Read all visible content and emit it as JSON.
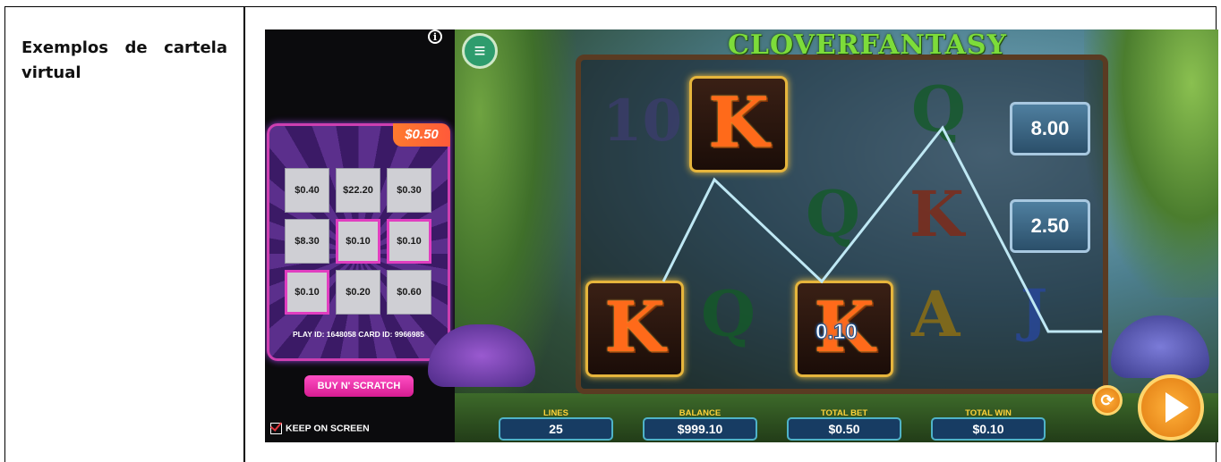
{
  "doc": {
    "label": "Exemplos de cartela virtual"
  },
  "scratch_card": {
    "info": "i",
    "price": "$0.50",
    "cells": [
      "$0.40",
      "$22.20",
      "$0.30",
      "$8.30",
      "$0.10",
      "$0.10",
      "$0.10",
      "$0.20",
      "$0.60"
    ],
    "highlighted": [
      false,
      false,
      false,
      false,
      true,
      true,
      true,
      false,
      false
    ],
    "ids": "PLAY ID: 1648058  CARD ID: 9966985",
    "buy_label": "BUY N' SCRATCH",
    "keep_label": "KEEP ON SCREEN",
    "keep_checked": true
  },
  "slot": {
    "title": "CLOVERFANTASY",
    "menu_icon": "≡",
    "symbols": {
      "ten": "10",
      "q": "Q",
      "a": "A",
      "j": "J",
      "k": "K"
    },
    "multipliers": [
      "8.00",
      "2.50"
    ],
    "win_value": "0.10",
    "hud": {
      "lines_caption": "LINES",
      "lines_value": "25",
      "balance_caption": "BALANCE",
      "balance_value": "$999.10",
      "bet_caption": "TOTAL BET",
      "bet_value": "$0.50",
      "win_caption": "TOTAL WIN",
      "win_value": "$0.10"
    },
    "autoplay_icon": "⟳",
    "spin_icon": "play-icon",
    "colors": {
      "accent": "#7ddc3a",
      "win_line": "#bfe8f4",
      "card_border": "#cc3fb0"
    }
  }
}
